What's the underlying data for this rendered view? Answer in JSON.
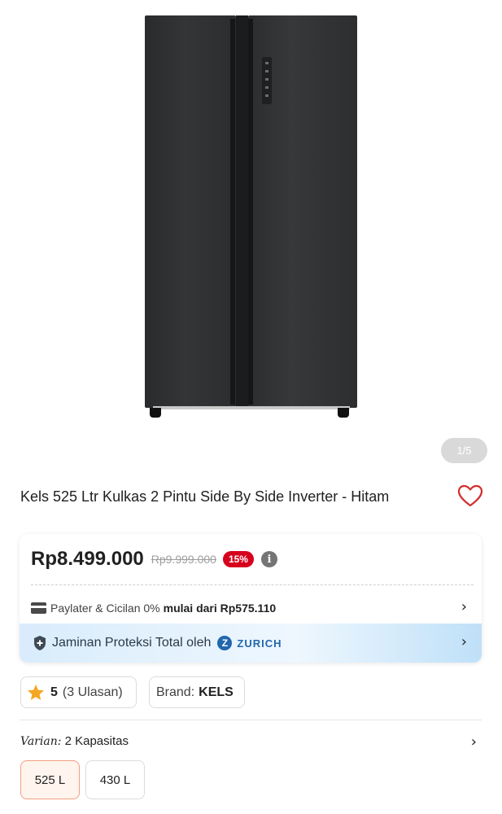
{
  "gallery": {
    "image_alt": "Kulkas 2 pintu side by side hitam",
    "counter": "1/5"
  },
  "product": {
    "title": "Kels 525 Ltr Kulkas 2 Pintu Side By Side Inverter - Hitam",
    "wishlist_icon": "heart-outline-icon"
  },
  "pricing": {
    "price": "Rp8.499.000",
    "original_price": "Rp9.999.000",
    "discount": "15%",
    "info_icon": "info-icon"
  },
  "paylater": {
    "label": "Paylater & Cicilan 0%",
    "highlight": "mulai dari Rp575.110",
    "icon": "credit-card-icon"
  },
  "protection": {
    "label": "Jaminan Proteksi Total oleh",
    "provider_logo_letter": "Z",
    "provider": "ZURICH",
    "icon": "shield-plus-icon"
  },
  "rating": {
    "value": "5",
    "reviews": "(3 Ulasan)",
    "star_color": "#f5a623"
  },
  "brand": {
    "label": "Brand:",
    "value": "KELS"
  },
  "variant": {
    "label": "Varian:",
    "value": "2 Kapasitas",
    "options": [
      {
        "label": "525 L",
        "selected": true
      },
      {
        "label": "430 L",
        "selected": false
      }
    ]
  },
  "colors": {
    "discount_badge": "#d6001c",
    "wishlist": "#d32f2f",
    "zurich_blue": "#2167ae",
    "selected_border": "#f2a07f"
  }
}
